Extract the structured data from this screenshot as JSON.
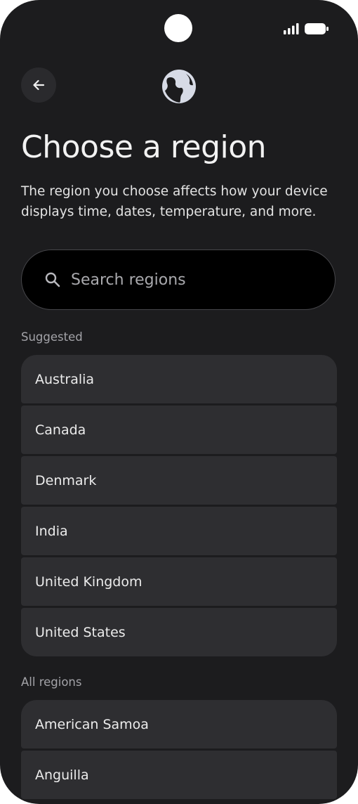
{
  "status_bar": {
    "signal_icon": "signal-bars-icon",
    "battery_icon": "battery-icon"
  },
  "header": {
    "back_icon": "arrow-back-icon",
    "globe_icon": "globe-icon"
  },
  "page": {
    "title": "Choose a region",
    "description": "The region you choose affects how your device displays time, dates, temperature, and more."
  },
  "search": {
    "placeholder": "Search regions",
    "icon": "search-icon"
  },
  "suggested": {
    "label": "Suggested",
    "items": [
      "Australia",
      "Canada",
      "Denmark",
      "India",
      "United Kingdom",
      "United States"
    ]
  },
  "all_regions": {
    "label": "All regions",
    "items": [
      "American Samoa",
      "Anguilla"
    ]
  },
  "colors": {
    "background": "#1c1c1e",
    "card": "#2e2e31",
    "search_bg": "#000000",
    "text_primary": "#f2f2f2",
    "text_secondary": "#a3a3a8"
  }
}
